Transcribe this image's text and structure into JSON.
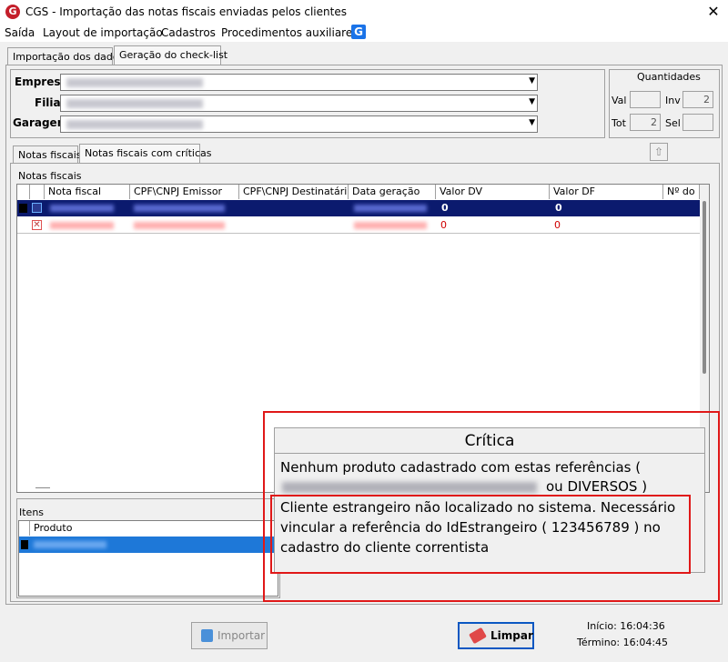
{
  "window": {
    "title": "CGS - Importação das notas fiscais enviadas pelos clientes",
    "logo": "G",
    "close": "✕"
  },
  "menu": [
    "Saída",
    "Layout de importação",
    "Cadastros",
    "Procedimentos auxiliares"
  ],
  "menu_logo": "G",
  "main_tabs": [
    "Importação dos dados",
    "Geração do check-list"
  ],
  "fields": {
    "empresa_label": "Empresa",
    "filial_label": "Filial",
    "garagem_label": "Garagem"
  },
  "quantidades": {
    "title": "Quantidades",
    "val_label": "Val",
    "val_value": "",
    "inv_label": "Inv",
    "inv_value": "2",
    "tot_label": "Tot",
    "tot_value": "2",
    "sel_label": "Sel",
    "sel_value": ""
  },
  "inner_tabs": [
    "Notas fiscais",
    "Notas fiscais com críticas"
  ],
  "notas": {
    "section_label": "Notas fiscais",
    "columns": [
      "Nota fiscal",
      "CPF\\CNPJ Emissor",
      "CPF\\CNPJ Destinatário",
      "Data geração",
      "Valor DV",
      "Valor DF",
      "Nº do"
    ],
    "rows": [
      {
        "valor_dv": "0",
        "valor_df": "0"
      },
      {
        "valor_dv": "0",
        "valor_df": "0"
      }
    ]
  },
  "itens": {
    "section_label": "Itens",
    "column": "Produto"
  },
  "critica": {
    "title": "Crítica",
    "msg1_line1": "Nenhum produto cadastrado com estas referências (",
    "msg1_line2": "ou DIVERSOS )",
    "msg2_line1": "Cliente estrangeiro não localizado no sistema. Necessário",
    "msg2_line2": "vincular a referência do IdEstrangeiro  ( 123456789 )  no",
    "msg2_line3": "cadastro do cliente correntista"
  },
  "buttons": {
    "importar": "Importar",
    "limpar": "Limpar"
  },
  "status": {
    "inicio": "Início: 16:04:36",
    "termino": "Término: 16:04:45"
  },
  "colors": {
    "selected_row": "#0b1a6e",
    "highlight": "#e01818",
    "error_text": "#d00000"
  }
}
